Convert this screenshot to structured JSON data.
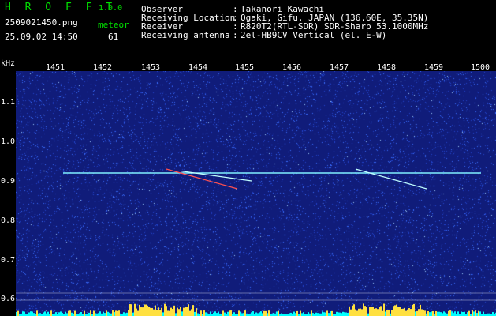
{
  "header": {
    "app_name": "H R O F F T",
    "version": "1.0.0",
    "filename": "2509021450.png",
    "datetime": "25.09.02 14:50",
    "meteor_label": "meteor",
    "meteor_count": "61",
    "rows": [
      {
        "label": "Observer",
        "sep": ":",
        "value": "Takanori Kawachi"
      },
      {
        "label": "Receiving Location",
        "sep": ":",
        "value": "Ogaki, Gifu, JAPAN (136.60E, 35.35N)"
      },
      {
        "label": "Receiver",
        "sep": ":",
        "value": "R820T2(RTL-SDR) SDR-Sharp 53.1000MHz"
      },
      {
        "label": "Receiving antenna",
        "sep": ":",
        "value": "2el-HB9CV Vertical (el. E-W)"
      }
    ]
  },
  "chart_data": {
    "type": "heatmap",
    "ylabel": "kHz",
    "x_ticks": [
      "1451",
      "1452",
      "1453",
      "1454",
      "1455",
      "1456",
      "1457",
      "1458",
      "1459",
      "1500"
    ],
    "y_ticks": [
      "1.1",
      "1.0",
      "0.9",
      "0.8",
      "0.7",
      "0.6"
    ],
    "ylim": [
      0.57,
      1.18
    ],
    "carrier_khz": 0.92,
    "echoes": [
      {
        "t": 14.534,
        "f0": 0.93,
        "f1": 0.88
      },
      {
        "t": 14.537,
        "f0": 0.925,
        "f1": 0.9
      },
      {
        "t": 14.574,
        "f0": 0.93,
        "f1": 0.88
      }
    ],
    "colors": {
      "background": "#101c7a",
      "noise": "#3a6cff",
      "carrier": "#80f0ff",
      "echo_hot": "#ff5050",
      "echo": "#c0ffff",
      "bars": "#ffe040",
      "bars_low": "#00ffff"
    }
  }
}
